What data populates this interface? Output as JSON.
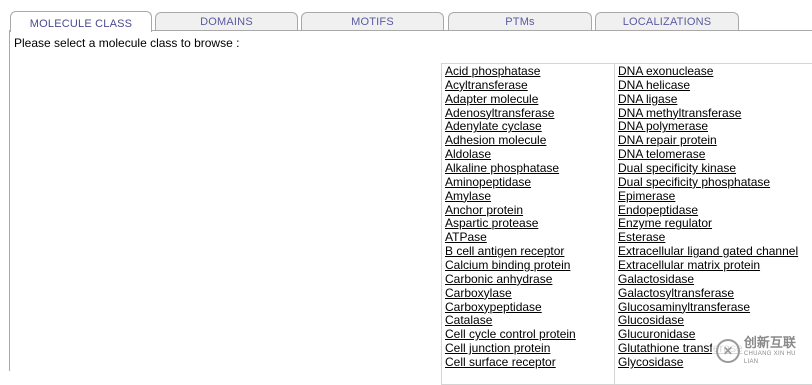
{
  "tabs": [
    {
      "label": "MOLECULE CLASS",
      "active": true
    },
    {
      "label": "DOMAINS",
      "active": false
    },
    {
      "label": "MOTIFS",
      "active": false
    },
    {
      "label": "PTMs",
      "active": false
    },
    {
      "label": "LOCALIZATIONS",
      "active": false
    }
  ],
  "prompt": "Please select a molecule class to browse :",
  "molecule_classes": {
    "left": [
      "Acid phosphatase",
      "Acyltransferase",
      "Adapter molecule",
      "Adenosyltransferase",
      "Adenylate cyclase",
      "Adhesion molecule",
      "Aldolase",
      "Alkaline phosphatase",
      "Aminopeptidase",
      "Amylase",
      "Anchor protein",
      "Aspartic protease",
      "ATPase",
      "B cell antigen receptor",
      "Calcium binding protein",
      "Carbonic anhydrase",
      "Carboxylase",
      "Carboxypeptidase",
      "Catalase",
      "Cell cycle control protein",
      "Cell junction protein",
      "Cell surface receptor"
    ],
    "right": [
      "DNA exonuclease",
      "DNA helicase",
      "DNA ligase",
      "DNA methyltransferase",
      "DNA polymerase",
      "DNA repair protein",
      "DNA telomerase",
      "Dual specificity kinase",
      "Dual specificity phosphatase",
      "Epimerase",
      "Endopeptidase",
      "Enzyme regulator",
      "Esterase",
      "Extracellular ligand gated channel",
      "Extracellular matrix protein",
      "Galactosidase",
      "Galactosyltransferase",
      "Glucosaminyltransferase",
      "Glucosidase",
      "Glucuronidase",
      "Glutathione transferase",
      "Glycosidase"
    ]
  },
  "watermark": {
    "name": "创新互联",
    "sub": "CHUANG XIN HU LIAN",
    "logo_glyph": "✕"
  },
  "colors": {
    "tab_text": "#5a5aa0",
    "tab_bg": "#f0f0f0",
    "border": "#a9a9a9"
  }
}
